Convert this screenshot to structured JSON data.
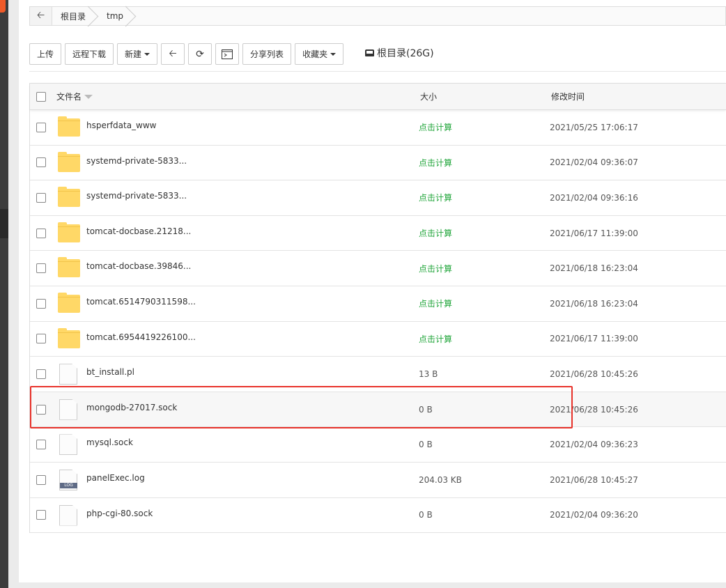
{
  "breadcrumb": {
    "items": [
      "根目录",
      "tmp"
    ]
  },
  "toolbar": {
    "upload": "上传",
    "remote_download": "远程下载",
    "new": "新建",
    "share_list": "分享列表",
    "favorites": "收藏夹",
    "disk_label": "根目录(26G)"
  },
  "table": {
    "headers": {
      "name": "文件名",
      "size": "大小",
      "modified": "修改时间"
    },
    "rows": [
      {
        "type": "folder",
        "name": "hsperfdata_www",
        "size": "点击计算",
        "modified": "2021/05/25 17:06:17"
      },
      {
        "type": "folder",
        "name": "systemd-private-5833...",
        "size": "点击计算",
        "modified": "2021/02/04 09:36:07"
      },
      {
        "type": "folder",
        "name": "systemd-private-5833...",
        "size": "点击计算",
        "modified": "2021/02/04 09:36:16"
      },
      {
        "type": "folder",
        "name": "tomcat-docbase.21218...",
        "size": "点击计算",
        "modified": "2021/06/17 11:39:00"
      },
      {
        "type": "folder",
        "name": "tomcat-docbase.39846...",
        "size": "点击计算",
        "modified": "2021/06/18 16:23:04"
      },
      {
        "type": "folder",
        "name": "tomcat.6514790311598...",
        "size": "点击计算",
        "modified": "2021/06/18 16:23:04"
      },
      {
        "type": "folder",
        "name": "tomcat.6954419226100...",
        "size": "点击计算",
        "modified": "2021/06/17 11:39:00"
      },
      {
        "type": "file",
        "name": "bt_install.pl",
        "size": "13 B",
        "modified": "2021/06/28 10:45:26"
      },
      {
        "type": "file",
        "name": "mongodb-27017.sock",
        "size": "0 B",
        "modified": "2021/06/28 10:45:26"
      },
      {
        "type": "file",
        "name": "mysql.sock",
        "size": "0 B",
        "modified": "2021/02/04 09:36:23"
      },
      {
        "type": "log",
        "name": "panelExec.log",
        "size": "204.03 KB",
        "modified": "2021/06/28 10:45:27",
        "icon_tag": "LOG"
      },
      {
        "type": "file",
        "name": "php-cgi-80.sock",
        "size": "0 B",
        "modified": "2021/02/04 09:36:20"
      }
    ]
  },
  "colors": {
    "calc": "#20a53a",
    "highlight": "#e8322a",
    "folder": "#ffd867"
  }
}
